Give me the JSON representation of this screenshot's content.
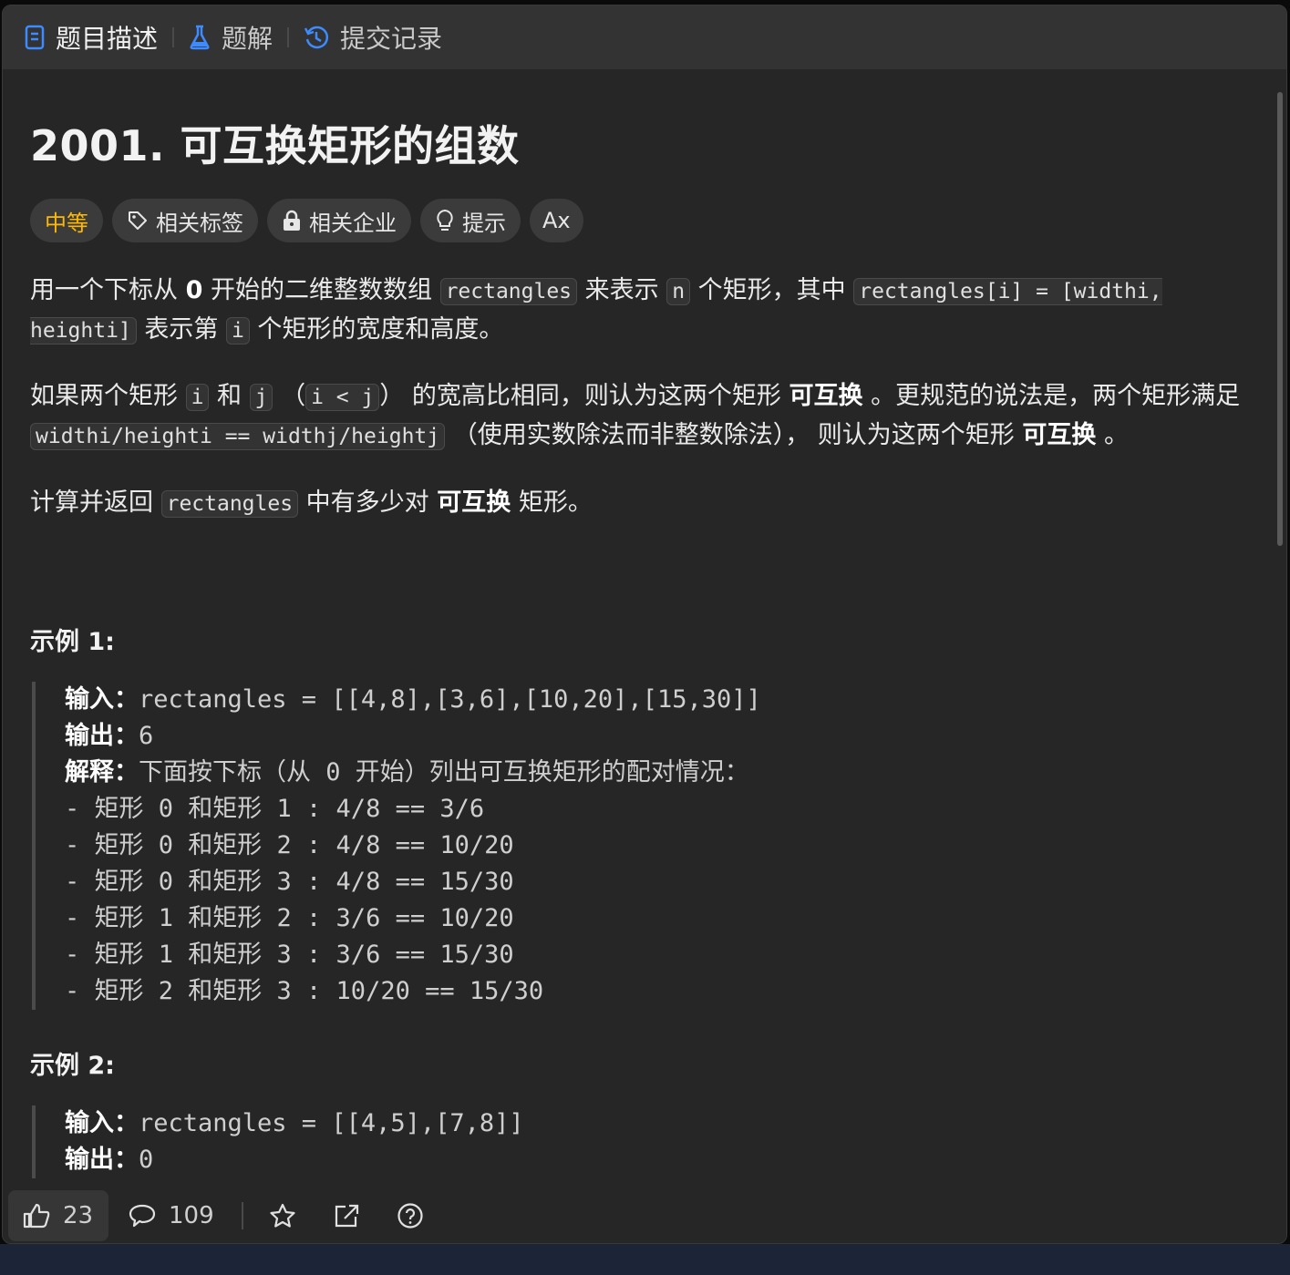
{
  "tabs": [
    {
      "label": "题目描述",
      "icon": "document-icon"
    },
    {
      "label": "题解",
      "icon": "flask-icon"
    },
    {
      "label": "提交记录",
      "icon": "history-icon"
    }
  ],
  "problem": {
    "title": "2001. 可互换矩形的组数",
    "difficulty": "中等",
    "chips": [
      {
        "label": "相关标签",
        "icon": "tag-icon"
      },
      {
        "label": "相关企业",
        "icon": "lock-icon"
      },
      {
        "label": "提示",
        "icon": "lightbulb-icon"
      }
    ],
    "font_chip": "Ax"
  },
  "desc": {
    "p1": {
      "a": "用一个下标从 ",
      "b": "0",
      "c": " 开始的二维整数数组 ",
      "code1": "rectangles",
      "d": " 来表示 ",
      "code2": "n",
      "e": " 个矩形，其中 ",
      "code3": "rectangles[i] = [widthi, heighti]",
      "f": " 表示第 ",
      "code4": "i",
      "g": " 个矩形的宽度和高度。"
    },
    "p2": {
      "a": "如果两个矩形 ",
      "code1": "i",
      "b": " 和 ",
      "code2": "j",
      "c": " （",
      "code3": "i < j",
      "d": "） 的宽高比相同，则认为这两个矩形 ",
      "bold1": "可互换",
      "e": " 。更规范的说法是，两个矩形满足 ",
      "code4": "widthi/heighti == widthj/heightj",
      "f": " （使用实数除法而非整数除法）， 则认为这两个矩形 ",
      "bold2": "可互换",
      "g": " 。"
    },
    "p3": {
      "a": "计算并返回 ",
      "code1": "rectangles",
      "b": " 中有多少对 ",
      "bold": "可互换",
      "c": " 矩形。"
    }
  },
  "examples": [
    {
      "title": "示例 1:",
      "input_label": "输入：",
      "input": "rectangles = [[4,8],[3,6],[10,20],[15,30]]",
      "output_label": "输出：",
      "output": "6",
      "explain_label": "解释：",
      "explain": "下面按下标（从 0 开始）列出可互换矩形的配对情况：",
      "lines": [
        "- 矩形 0 和矩形 1 : 4/8 == 3/6",
        "- 矩形 0 和矩形 2 : 4/8 == 10/20",
        "- 矩形 0 和矩形 3 : 4/8 == 15/30",
        "- 矩形 1 和矩形 2 : 3/6 == 10/20",
        "- 矩形 1 和矩形 3 : 3/6 == 15/30",
        "- 矩形 2 和矩形 3 : 10/20 == 15/30"
      ]
    },
    {
      "title": "示例 2:",
      "input_label": "输入：",
      "input": "rectangles = [[4,5],[7,8]]",
      "output_label": "输出：",
      "output": "0"
    }
  ],
  "footer": {
    "likes": "23",
    "comments": "109",
    "icons": [
      "thumbs-up-icon",
      "comment-icon",
      "star-icon",
      "share-icon",
      "help-icon"
    ]
  },
  "colors": {
    "panel_bg": "#262626",
    "tab_bg": "#333333",
    "difficulty_medium": "#ffb800",
    "tab_active_icon": "#3d8bff"
  }
}
